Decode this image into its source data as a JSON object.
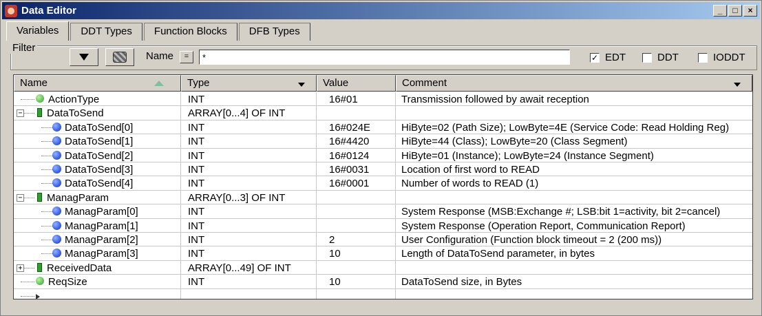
{
  "window": {
    "title": "Data Editor"
  },
  "tabs": [
    "Variables",
    "DDT Types",
    "Function Blocks",
    "DFB Types"
  ],
  "filter": {
    "label": "Filter",
    "name_label": "Name",
    "eq_label": "=",
    "name_value": "*",
    "checkboxes": [
      {
        "label": "EDT",
        "checked": true
      },
      {
        "label": "DDT",
        "checked": false
      },
      {
        "label": "IODDT",
        "checked": false
      }
    ]
  },
  "columns": [
    "Name",
    "Type",
    "Value",
    "Comment"
  ],
  "rows": [
    {
      "name": "ActionType",
      "type": "INT",
      "value": "16#01",
      "comment": "Transmission followed by await reception",
      "icon": "green-dot",
      "level": 0
    },
    {
      "name": "DataToSend",
      "type": "ARRAY[0...4] OF INT",
      "value": "",
      "comment": "",
      "icon": "struct",
      "level": 0,
      "expander": "−"
    },
    {
      "name": "DataToSend[0]",
      "type": "INT",
      "value": "16#024E",
      "comment": "HiByte=02 (Path Size); LowByte=4E (Service Code: Read Holding Reg)",
      "icon": "blue-dot",
      "level": 1
    },
    {
      "name": "DataToSend[1]",
      "type": "INT",
      "value": "16#4420",
      "comment": "HiByte=44 (Class); LowByte=20 (Class Segment)",
      "icon": "blue-dot",
      "level": 1
    },
    {
      "name": "DataToSend[2]",
      "type": "INT",
      "value": "16#0124",
      "comment": "HiByte=01 (Instance); LowByte=24 (Instance Segment)",
      "icon": "blue-dot",
      "level": 1
    },
    {
      "name": "DataToSend[3]",
      "type": "INT",
      "value": "16#0031",
      "comment": "Location of first word to READ",
      "icon": "blue-dot",
      "level": 1
    },
    {
      "name": "DataToSend[4]",
      "type": "INT",
      "value": "16#0001",
      "comment": "Number of words to READ (1)",
      "icon": "blue-dot",
      "level": 1
    },
    {
      "name": "ManagParam",
      "type": "ARRAY[0...3] OF INT",
      "value": "",
      "comment": "",
      "icon": "struct",
      "level": 0,
      "expander": "−"
    },
    {
      "name": "ManagParam[0]",
      "type": "INT",
      "value": "",
      "comment": "System Response (MSB:Exchange #; LSB:bit 1=activity, bit 2=cancel)",
      "icon": "blue-dot",
      "level": 1
    },
    {
      "name": "ManagParam[1]",
      "type": "INT",
      "value": "",
      "comment": "System Response (Operation Report, Communication Report)",
      "icon": "blue-dot",
      "level": 1
    },
    {
      "name": "ManagParam[2]",
      "type": "INT",
      "value": "2",
      "comment": "User Configuration (Function block timeout = 2 (200 ms))",
      "icon": "blue-dot",
      "level": 1
    },
    {
      "name": "ManagParam[3]",
      "type": "INT",
      "value": "10",
      "comment": "Length of DataToSend parameter, in bytes",
      "icon": "blue-dot",
      "level": 1
    },
    {
      "name": "ReceivedData",
      "type": "ARRAY[0...49] OF INT",
      "value": "",
      "comment": "",
      "icon": "struct",
      "level": 0,
      "expander": "+"
    },
    {
      "name": "ReqSize",
      "type": "INT",
      "value": "10",
      "comment": "DataToSend size, in Bytes",
      "icon": "green-dot",
      "level": 0
    },
    {
      "name": "",
      "type": "",
      "value": "",
      "comment": "",
      "icon": "arrow",
      "level": 0
    }
  ]
}
